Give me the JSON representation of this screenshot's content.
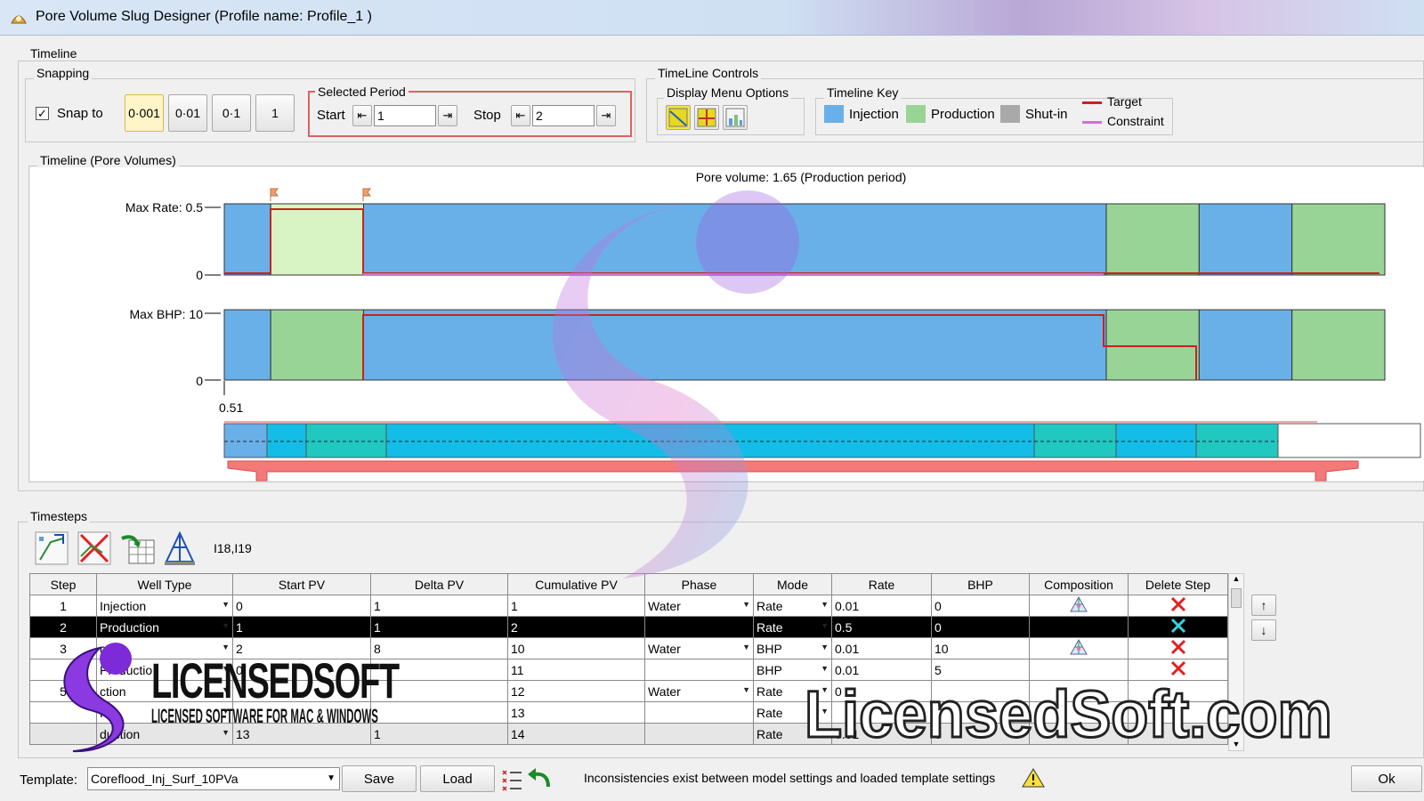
{
  "window": {
    "title": "Pore Volume Slug Designer (Profile name: Profile_1 )"
  },
  "timeline": {
    "group_label": "Timeline",
    "snapping": {
      "label": "Snapping",
      "snap_to_label": "Snap to",
      "snap_checked": true,
      "buttons": [
        "0·001",
        "0·01",
        "0·1",
        "1"
      ],
      "active_index": 0
    },
    "selected_period": {
      "label": "Selected Period",
      "start_label": "Start",
      "start_value": "1",
      "stop_label": "Stop",
      "stop_value": "2"
    },
    "controls": {
      "label": "TimeLine Controls",
      "display_menu_label": "Display Menu Options",
      "key_label": "Timeline Key",
      "key_items": [
        {
          "name": "Injection",
          "color": "#6ab0e8"
        },
        {
          "name": "Production",
          "color": "#99d497"
        },
        {
          "name": "Shut-in",
          "color": "#a9a9a9"
        }
      ],
      "line_items": [
        {
          "name": "Target",
          "color": "#cc2020"
        },
        {
          "name": "Constraint",
          "color": "#d070d8"
        }
      ]
    }
  },
  "plot": {
    "group_label": "Timeline (Pore Volumes)",
    "header": "Pore volume: 1.65 (Production period)",
    "rate_max_label": "Max Rate: 0.5",
    "rate_zero_label": "0",
    "bhp_max_label": "Max BHP: 10",
    "bhp_zero_label": "0",
    "axis_start_label": "0.51",
    "colors": {
      "injection": "#6ab0e8",
      "production": "#99d497",
      "selected": "#d9f4c4",
      "target": "#cc2020",
      "constraint": "#d070d8"
    },
    "segments": [
      {
        "type": "injection",
        "span": 1
      },
      {
        "type": "selected",
        "span": 2
      },
      {
        "type": "injection",
        "span": 16
      },
      {
        "type": "production",
        "span": 2
      },
      {
        "type": "injection",
        "span": 2
      },
      {
        "type": "production",
        "span": 2
      }
    ]
  },
  "timesteps": {
    "group_label": "Timesteps",
    "cell_ref": "I18,I19",
    "columns": [
      "Step",
      "Well Type",
      "Start PV",
      "Delta PV",
      "Cumulative PV",
      "Phase",
      "Mode",
      "Rate",
      "BHP",
      "Composition",
      "Delete Step"
    ],
    "rows": [
      {
        "step": "1",
        "well_type": "Injection",
        "start_pv": "0",
        "delta_pv": "1",
        "cum_pv": "1",
        "phase": "Water",
        "mode": "Rate",
        "rate": "0.01",
        "bhp": "0",
        "composition": true,
        "delete": true,
        "state": "normal"
      },
      {
        "step": "2",
        "well_type": "Production",
        "start_pv": "1",
        "delta_pv": "1",
        "cum_pv": "2",
        "phase": "",
        "mode": "Rate",
        "rate": "0.5",
        "bhp": "0",
        "composition": false,
        "delete": true,
        "state": "sel"
      },
      {
        "step": "3",
        "well_type": "ction",
        "start_pv": "2",
        "delta_pv": "8",
        "cum_pv": "10",
        "phase": "Water",
        "mode": "BHP",
        "rate": "0.01",
        "bhp": "10",
        "composition": true,
        "delete": true,
        "state": "normal"
      },
      {
        "step": "",
        "well_type": "Productio",
        "start_pv": "0",
        "delta_pv": "",
        "cum_pv": "11",
        "phase": "",
        "mode": "BHP",
        "rate": "0.01",
        "bhp": "5",
        "composition": false,
        "delete": true,
        "state": "normal"
      },
      {
        "step": "5",
        "well_type": "ction",
        "start_pv": "",
        "delta_pv": "",
        "cum_pv": "12",
        "phase": "Water",
        "mode": "Rate",
        "rate": "0",
        "bhp": "",
        "composition": false,
        "delete": false,
        "state": "normal"
      },
      {
        "step": "",
        "well_type": "Pro",
        "start_pv": "",
        "delta_pv": "",
        "cum_pv": "13",
        "phase": "",
        "mode": "Rate",
        "rate": "",
        "bhp": "",
        "composition": false,
        "delete": false,
        "state": "normal"
      },
      {
        "step": "",
        "well_type": "duction",
        "start_pv": "13",
        "delta_pv": "1",
        "cum_pv": "14",
        "phase": "",
        "mode": "Rate",
        "rate": "0.01",
        "bhp": "0",
        "composition": false,
        "delete": false,
        "state": "gray"
      }
    ]
  },
  "footer": {
    "template_label": "Template:",
    "template_value": "Coreflood_Inj_Surf_10PVa",
    "save_label": "Save",
    "load_label": "Load",
    "warning_text": "Inconsistencies exist between model settings and loaded template settings",
    "ok_label": "Ok"
  },
  "watermark": {
    "brand": "LICENSEDSOFT",
    "tagline": "LICENSED SOFTWARE FOR MAC & WINDOWS",
    "site": "LicensedSoft.com"
  }
}
